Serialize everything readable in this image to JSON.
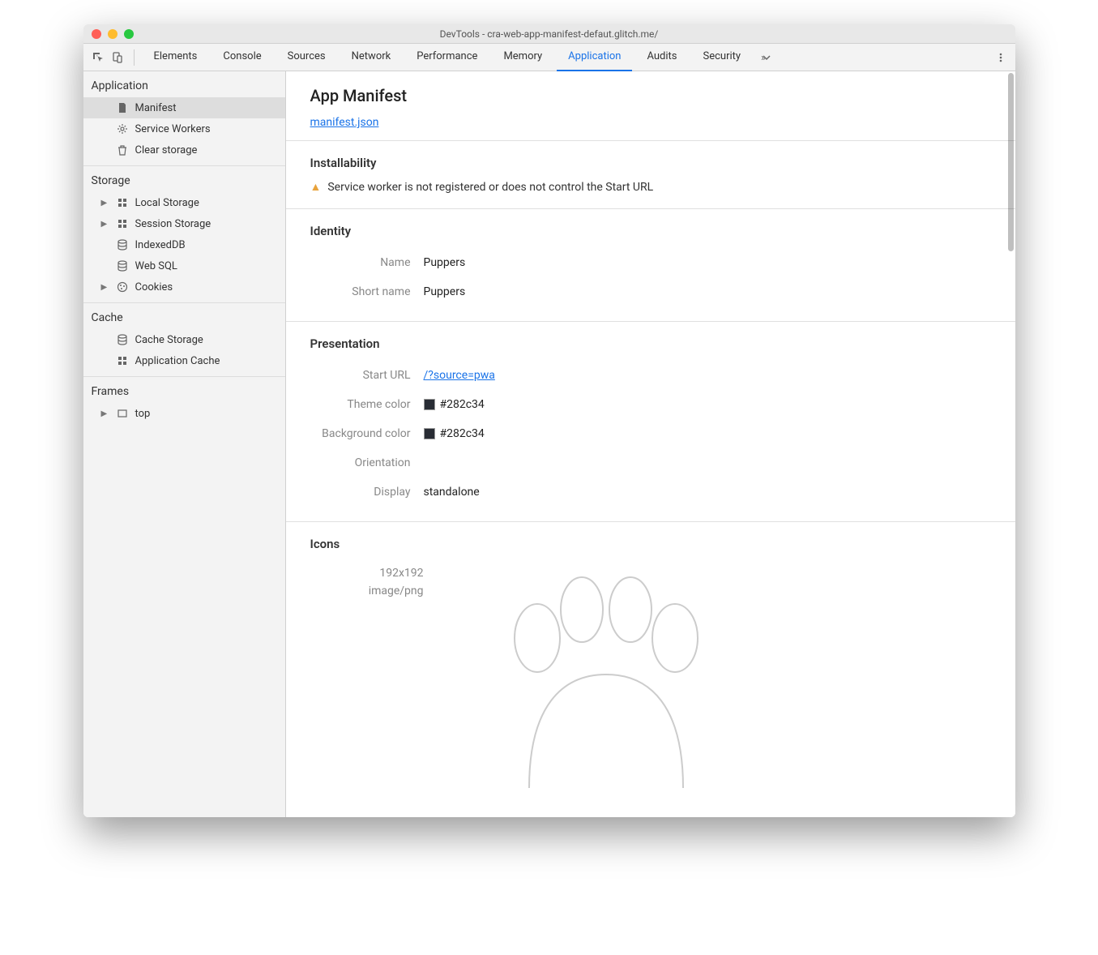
{
  "window": {
    "title": "DevTools - cra-web-app-manifest-defaut.glitch.me/"
  },
  "tabs": {
    "items": [
      "Elements",
      "Console",
      "Sources",
      "Network",
      "Performance",
      "Memory",
      "Application",
      "Audits",
      "Security"
    ],
    "active": "Application"
  },
  "sidebar": {
    "application": {
      "header": "Application",
      "items": [
        {
          "label": "Manifest",
          "icon": "document-icon",
          "selected": true
        },
        {
          "label": "Service Workers",
          "icon": "gear-icon"
        },
        {
          "label": "Clear storage",
          "icon": "trash-icon"
        }
      ]
    },
    "storage": {
      "header": "Storage",
      "items": [
        {
          "label": "Local Storage",
          "icon": "grid-icon",
          "expandable": true
        },
        {
          "label": "Session Storage",
          "icon": "grid-icon",
          "expandable": true
        },
        {
          "label": "IndexedDB",
          "icon": "database-icon"
        },
        {
          "label": "Web SQL",
          "icon": "database-icon"
        },
        {
          "label": "Cookies",
          "icon": "cookie-icon",
          "expandable": true
        }
      ]
    },
    "cache": {
      "header": "Cache",
      "items": [
        {
          "label": "Cache Storage",
          "icon": "database-icon"
        },
        {
          "label": "Application Cache",
          "icon": "grid-icon"
        }
      ]
    },
    "frames": {
      "header": "Frames",
      "items": [
        {
          "label": "top",
          "icon": "frame-icon",
          "expandable": true
        }
      ]
    }
  },
  "main": {
    "title": "App Manifest",
    "manifest_link": "manifest.json",
    "installability": {
      "header": "Installability",
      "warning": "Service worker is not registered or does not control the Start URL"
    },
    "identity": {
      "header": "Identity",
      "name_label": "Name",
      "name_value": "Puppers",
      "short_name_label": "Short name",
      "short_name_value": "Puppers"
    },
    "presentation": {
      "header": "Presentation",
      "start_url_label": "Start URL",
      "start_url_value": "/?source=pwa",
      "theme_color_label": "Theme color",
      "theme_color_value": "#282c34",
      "background_color_label": "Background color",
      "background_color_value": "#282c34",
      "orientation_label": "Orientation",
      "orientation_value": "",
      "display_label": "Display",
      "display_value": "standalone"
    },
    "icons": {
      "header": "Icons",
      "size": "192x192",
      "mime": "image/png"
    }
  },
  "colors": {
    "swatch": "#282c34"
  }
}
